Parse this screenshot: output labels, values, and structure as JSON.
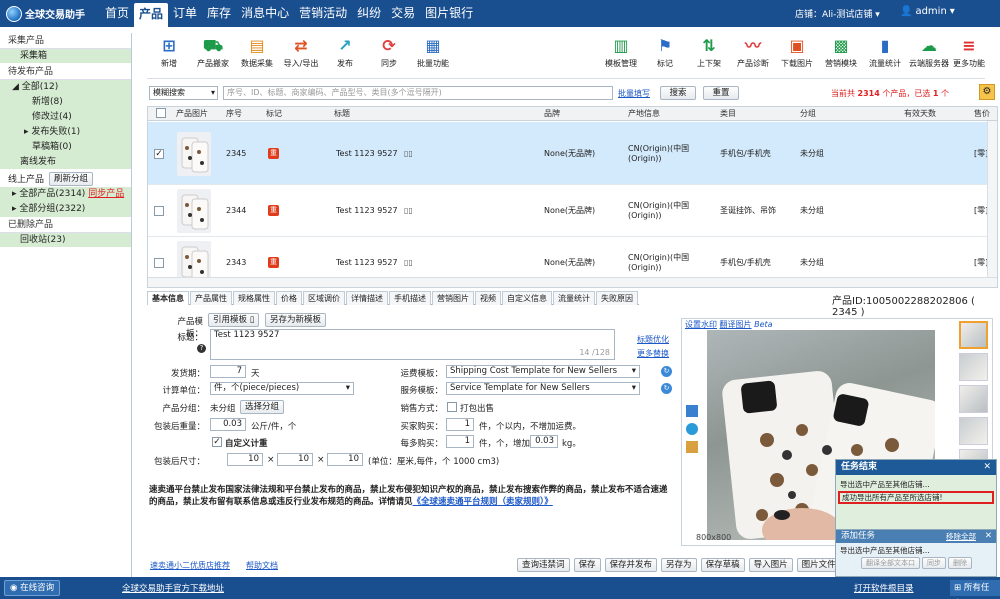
{
  "app": {
    "name": "全球交易助手",
    "nav": [
      "首页",
      "产品",
      "订单",
      "库存",
      "消息中心",
      "营销活动",
      "纠纷",
      "交易",
      "图片银行"
    ],
    "active_nav": "产品",
    "store_label": "店铺：",
    "store_name": "Ali-测试店铺",
    "user": "admin"
  },
  "sidebar": {
    "collect": "采集产品",
    "collect_box": "采集箱",
    "pending": "待发布产品",
    "all": "全部(12)",
    "new": "新增(8)",
    "modified": "修改过(4)",
    "failed": "发布失败(1)",
    "drafts": "草稿箱(0)",
    "offline": "离线发布",
    "online": "线上产品",
    "refresh_groups": "刷新分组",
    "all_products": "全部产品(2314)",
    "sync_products": "同步产品",
    "all_groups": "全部分组(2322)",
    "deleted": "已删除产品",
    "recycle": "回收站(23)"
  },
  "toolbar": [
    {
      "label": "新增",
      "icon": "plus-grid-icon",
      "color": "#2b6cc4"
    },
    {
      "label": "产品搬家",
      "icon": "truck-icon",
      "color": "#1d9b4a"
    },
    {
      "label": "数据采集",
      "icon": "collect-icon",
      "color": "#e08a1a"
    },
    {
      "label": "导入/导出",
      "icon": "import-export-icon",
      "color": "#e05020"
    },
    {
      "label": "发布",
      "icon": "publish-icon",
      "color": "#2aa0c0"
    },
    {
      "label": "同步",
      "icon": "sync-icon",
      "color": "#e04040"
    },
    {
      "label": "批量功能",
      "icon": "batch-icon",
      "color": "#2b6cc4"
    },
    {
      "label": "模板管理",
      "icon": "template-icon",
      "color": "#1d9b4a"
    },
    {
      "label": "标记",
      "icon": "flag-icon",
      "color": "#2b6cc4"
    },
    {
      "label": "上下架",
      "icon": "shelf-icon",
      "color": "#1d9b4a"
    },
    {
      "label": "产品诊断",
      "icon": "diagnose-icon",
      "color": "#e04040"
    },
    {
      "label": "下载图片",
      "icon": "download-image-icon",
      "color": "#e05020"
    },
    {
      "label": "营销模块",
      "icon": "marketing-icon",
      "color": "#1d9b4a"
    },
    {
      "label": "流量统计",
      "icon": "traffic-icon",
      "color": "#2b6cc4"
    },
    {
      "label": "云端服务器",
      "icon": "cloud-icon",
      "color": "#1d9b4a"
    },
    {
      "label": "更多功能",
      "icon": "more-icon",
      "color": "#e03030"
    }
  ],
  "filter": {
    "mode": "模糊搜索",
    "placeholder": "序号、ID、标题、商家编码、产品型号、类目(多个逗号隔开)",
    "batch_fill": "批量填写",
    "search": "搜索",
    "reset": "重置",
    "current_prefix": "当前共",
    "count": "2314",
    "current_mid": "个产品，已选",
    "selected": "1",
    "current_suffix": "个"
  },
  "grid": {
    "columns": [
      "产品图片",
      "序号",
      "标记",
      "标题",
      "品牌",
      "产地信息",
      "类目",
      "分组",
      "有效天数",
      "售价"
    ],
    "rows": [
      {
        "seq": "2345",
        "title": "Test 1123 9527",
        "brand": "None(无品牌)",
        "origin": "CN(Origin)(中国(Origin))",
        "category": "手机包/手机壳",
        "group": "未分组",
        "price": "[零]",
        "selected": true
      },
      {
        "seq": "2344",
        "title": "Test 1123 9527",
        "brand": "None(无品牌)",
        "origin": "CN(Origin)(中国(Origin))",
        "category": "圣诞挂饰、吊饰",
        "group": "未分组",
        "price": "[零]",
        "selected": false
      },
      {
        "seq": "2343",
        "title": "Test 1123 9527",
        "brand": "None(无品牌)",
        "origin": "CN(Origin)(中国(Origin))",
        "category": "手机包/手机壳",
        "group": "未分组",
        "price": "[零]",
        "selected": false
      }
    ],
    "mark": "重"
  },
  "detail": {
    "tabs": [
      "基本信息",
      "产品属性",
      "规格属性",
      "价格",
      "区域调价",
      "详情描述",
      "手机描述",
      "营销图片",
      "视频",
      "自定义信息",
      "流量统计",
      "失败原因"
    ],
    "product_id": "产品ID:1005002288202806 ( 2345 )",
    "template_label": "产品模板：",
    "use_template": "引用模板",
    "save_template": "另存为新模板",
    "title_label": "标题：",
    "title_value": "Test 1123 9527",
    "title_count": "14 /128",
    "title_optimize": "标题优化",
    "more_replace": "更多替换",
    "ship_label": "发货期：",
    "ship_value": "7",
    "ship_unit": "天",
    "unit_label": "计算单位：",
    "unit_value": "件，个(piece/pieces)",
    "group_label": "产品分组：",
    "group_value": "未分组",
    "choose_group": "选择分组",
    "weight_label": "包装后重量：",
    "weight_value": "0.03",
    "weight_unit": "公斤/件，个",
    "custom_weight": "自定义计重",
    "size_label": "包装后尺寸：",
    "size_l": "10",
    "size_w": "10",
    "size_h": "10",
    "size_unit": "(单位：厘米,每件，个  1000 cm3)",
    "freight_label": "运费模板：",
    "freight_value": "Shipping Cost Template for New Sellers",
    "service_label": "服务模板：",
    "service_value": "Service Template for New Sellers",
    "sale_label": "销售方式：",
    "sale_value": "打包出售",
    "buyer_label": "买家购买：",
    "buyer_value": "1",
    "buyer_unit": "件，个以内，不增加运费。",
    "each_label": "每多购买：",
    "each_value": "1",
    "each_mid": "件，个，增加",
    "each_weight": "0.03",
    "each_unit": "kg。",
    "notice": "速卖通平台禁止发布国家法律法规和平台禁止发布的商品，禁止发布侵犯知识产权的商品，禁止发布搜索作弊的商品，禁止发布不适合速递的商品，禁止发布留有联系信息或违反行业发布规范的商品。详情请见",
    "notice_link": "《全球速卖通平台规则（卖家规则）》",
    "watermark": "设置水印",
    "translate": "翻译图片",
    "beta": "Beta",
    "size": "800x800"
  },
  "bottom": {
    "link1": "速卖通小二优质店推荐",
    "link2": "帮助文档",
    "buttons": [
      "查询违禁词",
      "保存",
      "保存并发布",
      "另存为",
      "保存草稿",
      "导入图片",
      "图片文件"
    ]
  },
  "popup": {
    "title": "任务结束",
    "line1": "导出选中产品至其他店铺...",
    "line2": "成功导出所有产品至所选店铺!",
    "add_task": "添加任务",
    "remove_all": "移除全部",
    "task1": "导出选中产品至其他店铺...",
    "refresh": "翻译全部文本口",
    "sync": "同步",
    "delete": "删除",
    "open_dir": "打开软件根目录",
    "all_tasks": "所有任务"
  },
  "status": {
    "online_help": "在线咨询",
    "download": "全球交易助手官方下载地址"
  }
}
